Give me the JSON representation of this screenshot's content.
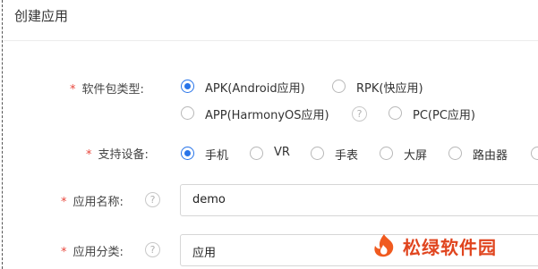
{
  "header": {
    "title": "创建应用"
  },
  "form": {
    "required_mark": "*",
    "package_type": {
      "label": "软件包类型:",
      "options": [
        "APK(Android应用)",
        "RPK(快应用)",
        "APP(HarmonyOS应用)",
        "PC(PC应用)"
      ],
      "selected": "APK(Android应用)",
      "help_symbol": "?"
    },
    "devices": {
      "label": "支持设备:",
      "options": [
        "手机",
        "VR",
        "手表",
        "大屏",
        "路由器"
      ],
      "selected": "手机"
    },
    "app_name": {
      "label": "应用名称:",
      "value": "demo",
      "help_symbol": "?"
    },
    "app_category": {
      "label": "应用分类:",
      "value": "应用",
      "help_symbol": "?"
    }
  },
  "watermark": {
    "text": "松绿软件园",
    "color": "#e0451f"
  }
}
